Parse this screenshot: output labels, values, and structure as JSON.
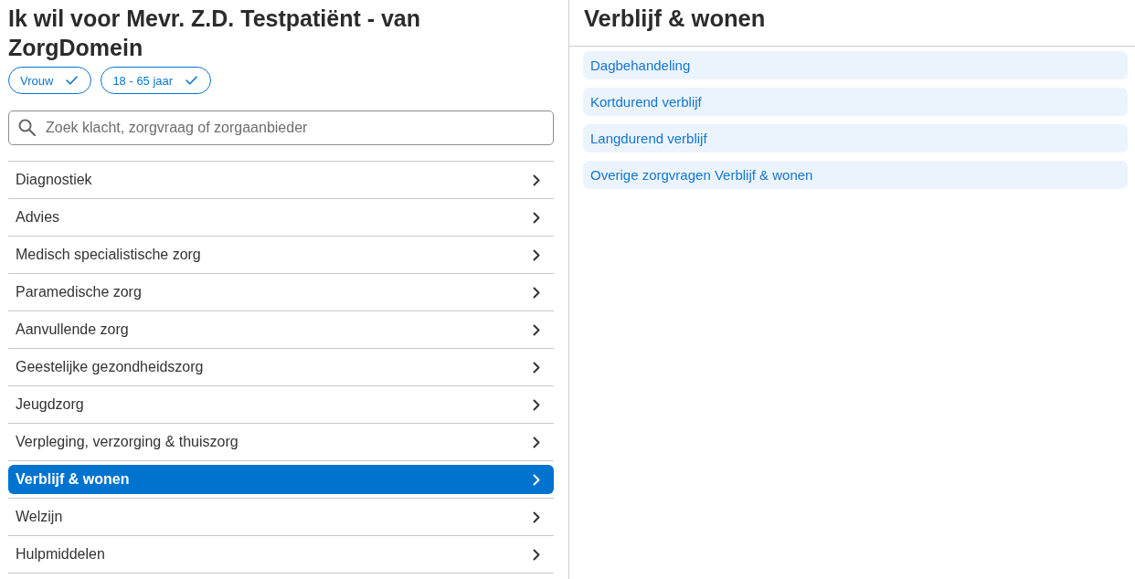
{
  "patient_panel": {
    "title": "Ik wil voor Mevr. Z.D. Testpatiënt - van ZorgDomein",
    "filters": [
      {
        "label": "Vrouw",
        "checked": true
      },
      {
        "label": "18 - 65 jaar",
        "checked": true
      }
    ],
    "search": {
      "placeholder": "Zoek klacht, zorgvraag of zorgaanbieder"
    },
    "categories": [
      {
        "label": "Diagnostiek",
        "selected": false
      },
      {
        "label": "Advies",
        "selected": false
      },
      {
        "label": "Medisch specialistische zorg",
        "selected": false
      },
      {
        "label": "Paramedische zorg",
        "selected": false
      },
      {
        "label": "Aanvullende zorg",
        "selected": false
      },
      {
        "label": "Geestelijke gezondheidszorg",
        "selected": false
      },
      {
        "label": "Jeugdzorg",
        "selected": false
      },
      {
        "label": "Verpleging, verzorging & thuiszorg",
        "selected": false
      },
      {
        "label": "Verblijf & wonen",
        "selected": true
      },
      {
        "label": "Welzijn",
        "selected": false
      },
      {
        "label": "Hulpmiddelen",
        "selected": false
      }
    ]
  },
  "detail_panel": {
    "title": "Verblijf & wonen",
    "items": [
      {
        "label": "Dagbehandeling"
      },
      {
        "label": "Kortdurend verblijf"
      },
      {
        "label": "Langdurend verblijf"
      },
      {
        "label": "Overige zorgvragen Verblijf & wonen"
      }
    ]
  }
}
